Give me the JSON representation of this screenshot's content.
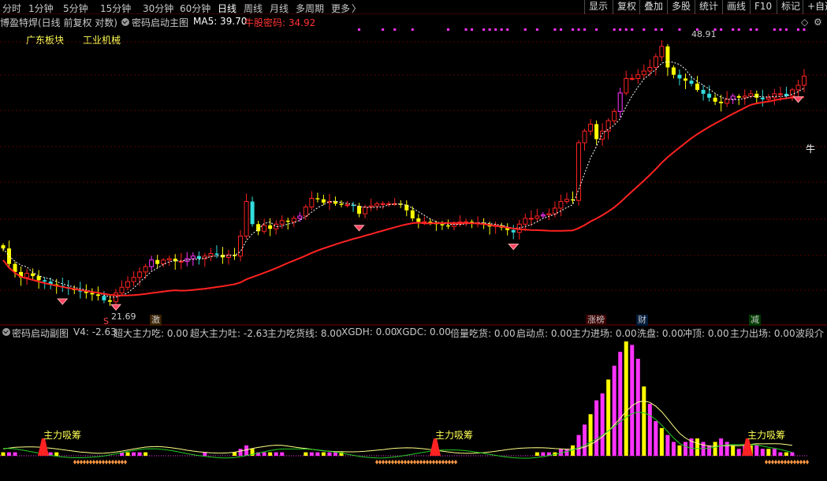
{
  "toolbar": {
    "periods": [
      "分时",
      "1分钟",
      "5分钟",
      "15分钟",
      "30分钟",
      "60分钟",
      "日线",
      "周线",
      "月线",
      "多周期",
      "更多"
    ],
    "more_arrow": "〉",
    "buttons": [
      "显示",
      "复权",
      "叠加",
      "多股",
      "统计",
      "画线",
      "F10",
      "标记",
      "+自选"
    ]
  },
  "info": {
    "stock_title": "博盈特焊(日线 前复权 对数)",
    "indicator_name": "密码启动主图",
    "ma5_label": "MA5: 39.70",
    "niugu_label": "牛股密码: 34.92"
  },
  "top_icons": {
    "diamond": "◇",
    "gear": "⚙"
  },
  "sectors": [
    "广东板块",
    "工业机械"
  ],
  "events": [
    {
      "label": "激",
      "color": "#ff8800"
    },
    {
      "label": "涨榜",
      "color": "#ff4444"
    },
    {
      "label": "财",
      "color": "#44aaff"
    },
    {
      "label": "减",
      "color": "#44ff44"
    }
  ],
  "prices": {
    "high": "48.91",
    "low": "21.69"
  },
  "markers": {
    "niu_label": "牛",
    "s_label": "S"
  },
  "sub": {
    "name": "密码启动副图",
    "items": [
      {
        "text": "V4: -2.63",
        "color": "#c8c8c8"
      },
      {
        "text": "超大主力吃: 0.00",
        "color": "#ff44ff"
      },
      {
        "text": "超大主力吐: -2.63",
        "color": "#44ff44"
      },
      {
        "text": "主力吃货线: 8.00",
        "color": "#ff44ff"
      },
      {
        "text": "XGDH: 0.00",
        "color": "#c8c8c8"
      },
      {
        "text": "XGDC: 0.00",
        "color": "#2244ff"
      },
      {
        "text": "倍量吃货: 0.00",
        "color": "#ffff55"
      },
      {
        "text": "启动点: 0.00",
        "color": "#ffff55"
      },
      {
        "text": "主力进场: 0.00",
        "color": "#ff3333"
      },
      {
        "text": "洗盘: 0.00",
        "color": "#44ff44"
      },
      {
        "text": "冲顶: 0.00",
        "color": "#ff44ff"
      },
      {
        "text": "主力出场: 0.00",
        "color": "#ffff55"
      },
      {
        "text": "波段介",
        "color": "#ffffff"
      }
    ],
    "zl_label": "主力吸筹"
  },
  "colors": {
    "yellow": "#ffff00",
    "magenta": "#ff33ff",
    "red": "#ff2222",
    "cyan": "#33dddd",
    "grid": "#5a0000"
  },
  "chart_data": [
    {
      "type": "candlestick",
      "title": "密码启动主图",
      "y_axis": "log",
      "price_high": 48.91,
      "price_low": 21.69,
      "ma5_last": 39.7,
      "niugu_mima_last": 34.92,
      "closes": [
        25.8,
        24.6,
        24.0,
        23.6,
        23.9,
        23.7,
        23.4,
        23.3,
        23.1,
        23.0,
        22.9,
        22.8,
        22.7,
        22.6,
        22.5,
        22.4,
        22.3,
        22.0,
        21.9,
        22.5,
        22.9,
        23.3,
        23.6,
        24.0,
        24.4,
        24.9,
        24.6,
        24.9,
        25.0,
        24.8,
        24.8,
        25.0,
        25.2,
        25.0,
        25.2,
        25.4,
        25.3,
        25.1,
        25.3,
        25.2,
        26.8,
        29.8,
        27.8,
        27.2,
        27.7,
        27.4,
        27.8,
        28.1,
        28.0,
        28.3,
        28.5,
        29.3,
        30.1,
        30.0,
        29.7,
        29.8,
        29.6,
        29.5,
        29.5,
        29.4,
        28.7,
        29.3,
        29.4,
        29.6,
        29.6,
        29.6,
        29.6,
        29.5,
        29.0,
        28.3,
        28.0,
        28.0,
        27.9,
        27.8,
        27.7,
        27.6,
        27.8,
        28.0,
        28.0,
        27.9,
        27.9,
        27.8,
        27.6,
        27.7,
        27.5,
        27.3,
        27.1,
        27.8,
        28.3,
        28.3,
        28.5,
        28.6,
        28.7,
        29.2,
        29.8,
        30.0,
        29.9,
        35.7,
        37.0,
        37.8,
        36.1,
        37.0,
        38.2,
        39.3,
        41.6,
        43.5,
        43.5,
        44.0,
        44.5,
        45.0,
        46.5,
        48.0,
        45.0,
        44.0,
        43.5,
        43.2,
        42.8,
        42.0,
        41.5,
        41.0,
        40.5,
        40.3,
        40.8,
        41.2,
        41.0,
        41.2,
        41.5,
        41.0,
        40.8,
        41.0,
        41.5,
        41.5,
        41.2,
        42.0,
        42.6,
        43.8
      ]
    },
    {
      "type": "bar",
      "title": "密码启动副图",
      "annotations": [
        "主力吸筹",
        "主力吸筹",
        "主力吸筹"
      ],
      "v4_last": -2.63,
      "values": [
        1,
        1,
        1,
        0,
        0,
        0,
        0,
        0,
        1,
        1,
        0,
        0,
        0,
        0,
        0,
        0,
        0,
        0,
        0,
        0,
        1,
        1,
        1,
        1,
        1,
        0,
        0,
        0,
        0,
        0,
        0,
        0,
        0,
        0,
        1,
        0,
        0,
        0,
        0,
        1,
        2,
        3,
        2,
        1,
        1,
        1,
        1,
        1,
        0,
        0,
        0,
        1,
        1,
        1,
        1,
        1,
        1,
        1,
        0,
        0,
        0,
        0,
        0,
        0,
        0,
        0,
        0,
        0,
        0,
        0,
        0,
        0,
        0,
        0,
        0,
        0,
        0,
        0,
        0,
        0,
        0,
        0,
        0,
        0,
        0,
        0,
        0,
        0,
        0,
        0,
        1,
        1,
        1,
        1,
        2,
        2,
        3,
        6,
        9,
        12,
        16,
        18,
        22,
        26,
        30,
        33,
        32,
        28,
        20,
        15,
        10,
        8,
        6,
        4,
        3,
        4,
        5,
        5,
        4,
        3,
        4,
        5,
        4,
        3,
        2,
        3,
        3,
        3,
        2,
        2,
        2,
        1,
        1,
        1
      ]
    }
  ]
}
